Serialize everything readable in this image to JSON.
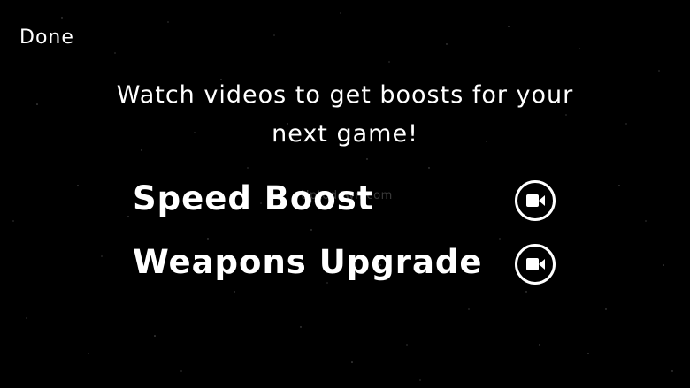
{
  "screen": {
    "background_color": "#000000",
    "text_color": "#ffffff"
  },
  "header": {
    "done_label": "Done"
  },
  "headline": {
    "line1": "Watch videos to get boosts for your",
    "line2": "next game!"
  },
  "boosts": [
    {
      "label": "Speed Boost",
      "icon": "video-camera-icon"
    },
    {
      "label": "Weapons Upgrade",
      "icon": "video-camera-icon"
    }
  ],
  "watermark": {
    "text": "Uptodown.com"
  }
}
